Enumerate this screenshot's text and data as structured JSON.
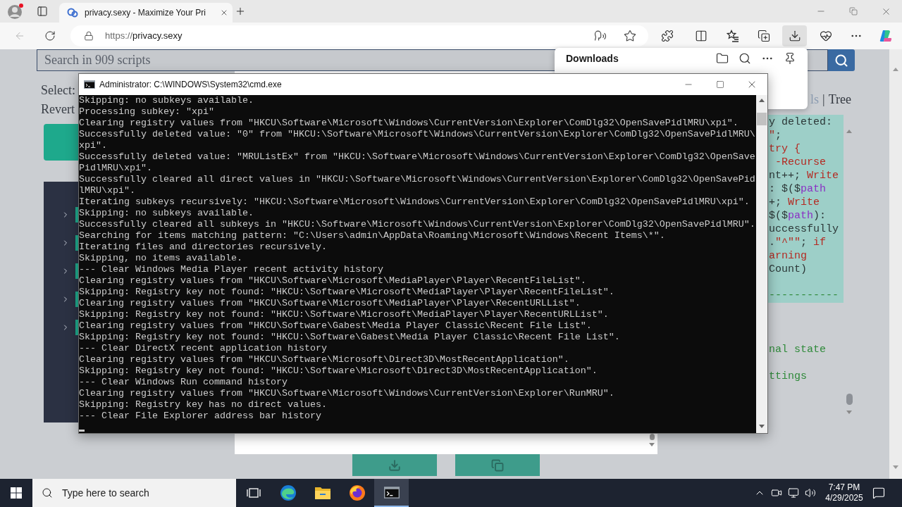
{
  "browser": {
    "tab": {
      "title": "privacy.sexy - Maximize Your Pri"
    },
    "address": {
      "scheme": "https://",
      "host": "privacy.sexy"
    },
    "downloads_button": {
      "selected": true
    }
  },
  "downloads_panel": {
    "title": "Downloads"
  },
  "page": {
    "search": {
      "placeholder": "Search in 909 scripts"
    },
    "select_label": "Select:",
    "revert_label": "Revert",
    "tree_rows": [
      {
        "expanded": false
      },
      {
        "expanded": false
      },
      {
        "expanded": false
      },
      {
        "expanded": false
      },
      {
        "expanded": false
      }
    ],
    "view_options": [
      {
        "label": "ls",
        "selected": false
      },
      {
        "label": "Tree",
        "selected": true
      }
    ],
    "view_separator": "|",
    "code_lines": [
      {
        "tokens": [
          {
            "text": "y deleted:",
            "kind": "plain"
          }
        ]
      },
      {
        "tokens": [
          {
            "text": "\"",
            "kind": "string"
          },
          {
            "text": ";",
            "kind": "plain"
          }
        ]
      },
      {
        "tokens": [
          {
            "text": "try {",
            "kind": "keyword"
          }
        ]
      },
      {
        "tokens": [
          {
            "text": " -Recurse",
            "kind": "keyword"
          }
        ]
      },
      {
        "tokens": [
          {
            "text": "nt++; ",
            "kind": "plain"
          },
          {
            "text": "Write",
            "kind": "keyword"
          }
        ]
      },
      {
        "tokens": [
          {
            "text": ": $($",
            "kind": "plain"
          },
          {
            "text": "path",
            "kind": "variable"
          }
        ]
      },
      {
        "tokens": [
          {
            "text": "+; ",
            "kind": "plain"
          },
          {
            "text": "Write",
            "kind": "keyword"
          }
        ]
      },
      {
        "tokens": [
          {
            "text": "$($",
            "kind": "plain"
          },
          {
            "text": "path",
            "kind": "variable"
          },
          {
            "text": "):",
            "kind": "plain"
          }
        ]
      },
      {
        "tokens": [
          {
            "text": "uccessfully",
            "kind": "plain"
          }
        ]
      },
      {
        "tokens": [
          {
            "text": ".",
            "kind": "plain"
          },
          {
            "text": "\"^\"\"",
            "kind": "string"
          },
          {
            "text": "; ",
            "kind": "plain"
          },
          {
            "text": "if",
            "kind": "keyword"
          }
        ]
      },
      {
        "tokens": [
          {
            "text": "arning",
            "kind": "keyword"
          }
        ]
      },
      {
        "tokens": [
          {
            "text": "Count)",
            "kind": "plain"
          }
        ]
      }
    ],
    "code_rule": "-----------",
    "comment_lines": [
      "nal state",
      "ttings"
    ]
  },
  "cmd_window": {
    "title": "Administrator: C:\\WINDOWS\\System32\\cmd.exe",
    "lines": [
      "Skipping: no subkeys available.",
      "Processing subkey: \"xpi\"",
      "Clearing registry values from \"HKCU\\Software\\Microsoft\\Windows\\CurrentVersion\\Explorer\\ComDlg32\\OpenSavePidlMRU\\xpi\".",
      "Successfully deleted value: \"0\" from \"HKCU:\\Software\\Microsoft\\Windows\\CurrentVersion\\Explorer\\ComDlg32\\OpenSavePidlMRU\\",
      "xpi\".",
      "Successfully deleted value: \"MRUListEx\" from \"HKCU:\\Software\\Microsoft\\Windows\\CurrentVersion\\Explorer\\ComDlg32\\OpenSave",
      "PidlMRU\\xpi\".",
      "Successfully cleared all direct values in \"HKCU:\\Software\\Microsoft\\Windows\\CurrentVersion\\Explorer\\ComDlg32\\OpenSavePid",
      "lMRU\\xpi\".",
      "Iterating subkeys recursively: \"HKCU:\\Software\\Microsoft\\Windows\\CurrentVersion\\Explorer\\ComDlg32\\OpenSavePidlMRU\\xpi\".",
      "Skipping: no subkeys available.",
      "Successfully cleared all subkeys in \"HKCU:\\Software\\Microsoft\\Windows\\CurrentVersion\\Explorer\\ComDlg32\\OpenSavePidlMRU\".",
      "Searching for items matching pattern: \"C:\\Users\\admin\\AppData\\Roaming\\Microsoft\\Windows\\Recent Items\\*\".",
      "Iterating files and directories recursively.",
      "Skipping, no items available.",
      "--- Clear Windows Media Player recent activity history",
      "Clearing registry values from \"HKCU\\Software\\Microsoft\\MediaPlayer\\Player\\RecentFileList\".",
      "Skipping: Registry key not found: \"HKCU:\\Software\\Microsoft\\MediaPlayer\\Player\\RecentFileList\".",
      "Clearing registry values from \"HKCU\\Software\\Microsoft\\MediaPlayer\\Player\\RecentURLList\".",
      "Skipping: Registry key not found: \"HKCU:\\Software\\Microsoft\\MediaPlayer\\Player\\RecentURLList\".",
      "Clearing registry values from \"HKCU\\Software\\Gabest\\Media Player Classic\\Recent File List\".",
      "Skipping: Registry key not found: \"HKCU:\\Software\\Gabest\\Media Player Classic\\Recent File List\".",
      "--- Clear DirectX recent application history",
      "Clearing registry values from \"HKCU\\Software\\Microsoft\\Direct3D\\MostRecentApplication\".",
      "Skipping: Registry key not found: \"HKCU:\\Software\\Microsoft\\Direct3D\\MostRecentApplication\".",
      "--- Clear Windows Run command history",
      "Clearing registry values from \"HKCU\\Software\\Microsoft\\Windows\\CurrentVersion\\Explorer\\RunMRU\".",
      "Skipping: Registry key has no direct values.",
      "--- Clear File Explorer address bar history"
    ]
  },
  "taskbar": {
    "search_placeholder": "Type here to search",
    "apps": [
      {
        "selected": false
      },
      {
        "selected": false
      },
      {
        "selected": false
      },
      {
        "selected": false
      },
      {
        "selected": true
      }
    ],
    "time": "7:47 PM",
    "date": "4/29/2025"
  }
}
